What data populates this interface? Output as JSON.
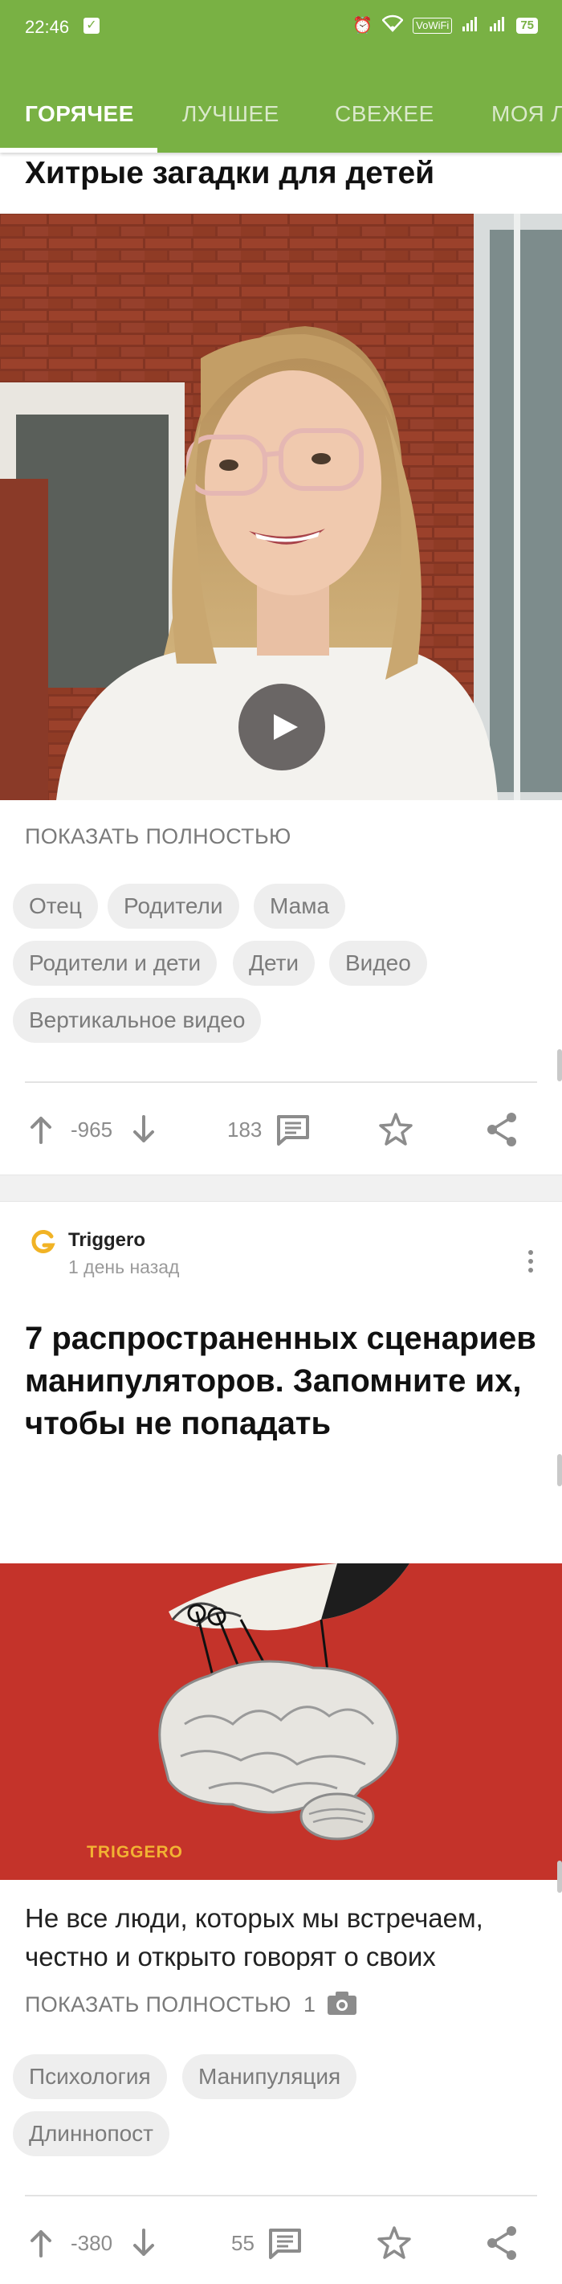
{
  "status_bar": {
    "time": "22:46",
    "vowifi": "VoWiFi",
    "battery": "75"
  },
  "tabs": [
    {
      "label": "ГОРЯЧЕЕ",
      "active": true
    },
    {
      "label": "ЛУЧШЕЕ",
      "active": false
    },
    {
      "label": "СВЕЖЕЕ",
      "active": false
    },
    {
      "label": "МОЯ Л",
      "active": false
    }
  ],
  "post1": {
    "title": "Хитрые загадки для детей",
    "show_more": "ПОКАЗАТЬ ПОЛНОСТЬЮ",
    "tags": [
      "Отец",
      "Родители",
      "Мама",
      "Родители и дети",
      "Дети",
      "Видео",
      "Вертикальное видео"
    ],
    "rating": "-965",
    "comments": "183"
  },
  "post2": {
    "author": "Triggero",
    "date": "1 день назад",
    "title": "7 распространенных сценариев манипуляторов. Запомните их, чтобы не попадать",
    "image_caption": "TRIGGERO",
    "excerpt": "Не все люди, которых мы встречаем, честно и открыто говорят о своих",
    "show_more": "ПОКАЗАТЬ ПОЛНОСТЬЮ",
    "photo_count": "1",
    "tags": [
      "Психология",
      "Манипуляция",
      "Длиннопост"
    ],
    "rating": "-380",
    "comments": "55"
  },
  "colors": {
    "brand_green": "#79b144",
    "image_red": "#c4332a"
  }
}
